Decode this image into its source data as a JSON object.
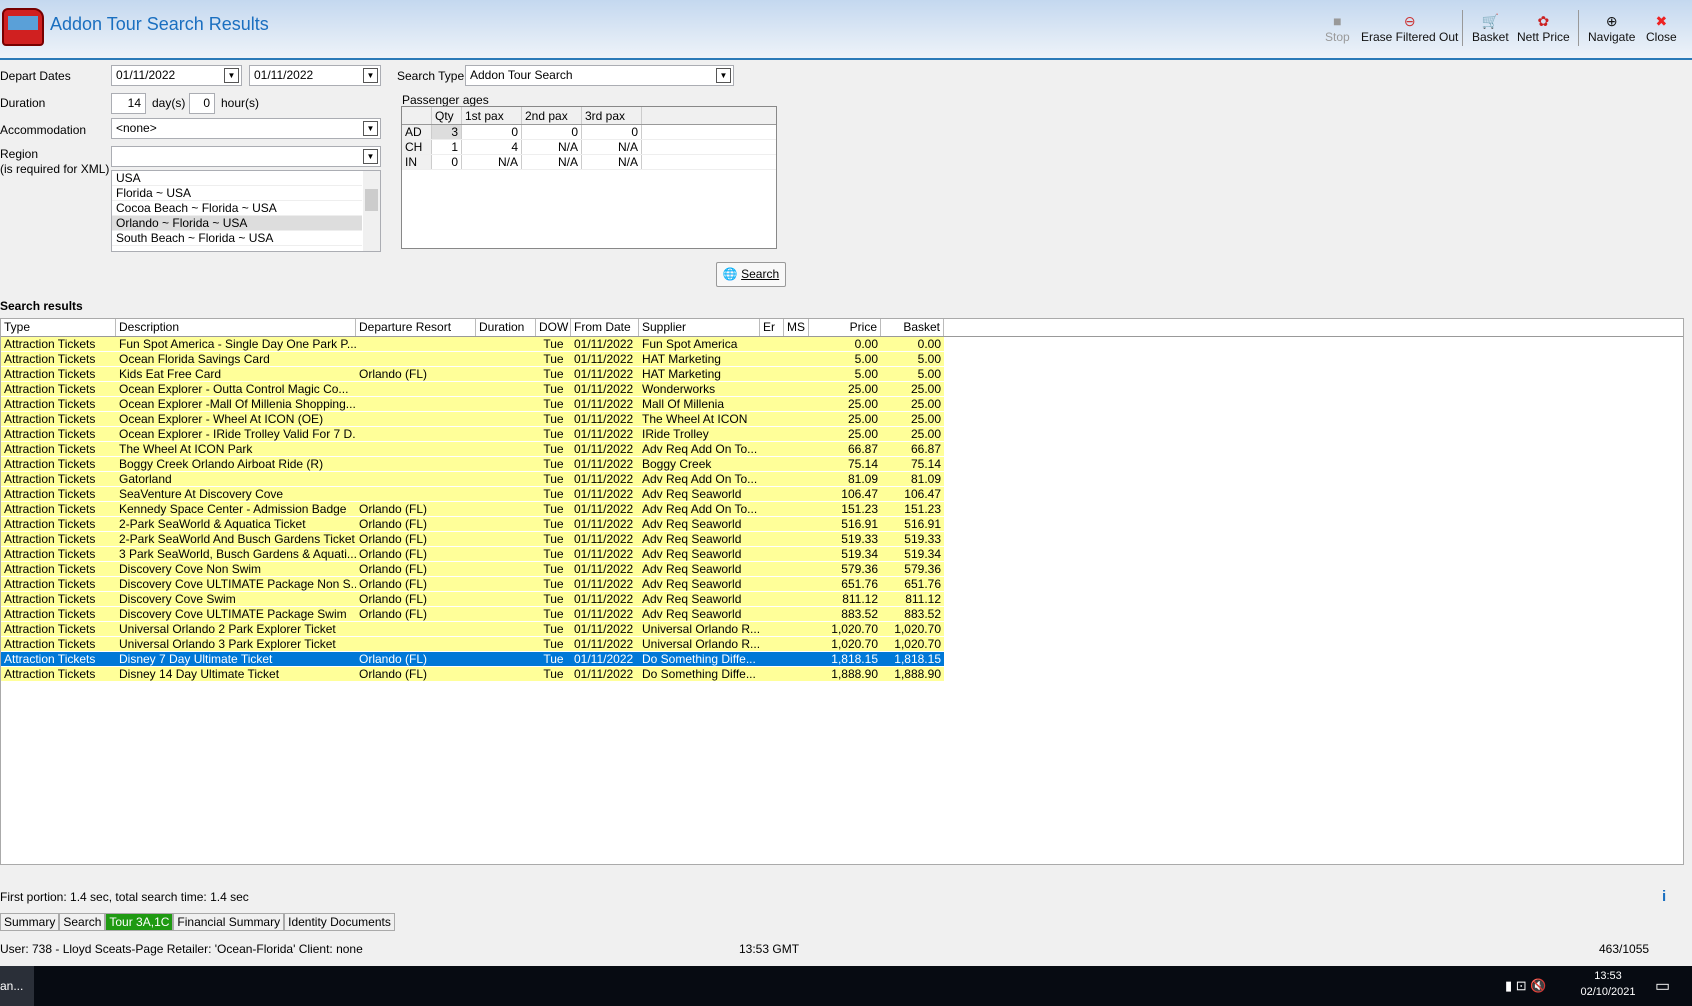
{
  "window": {
    "title": "Addon Tour Search Results"
  },
  "toolbar": {
    "stop": "Stop",
    "erase": "Erase Filtered Out",
    "basket": "Basket",
    "nett": "Nett Price",
    "navigate": "Navigate",
    "close": "Close"
  },
  "form": {
    "depart_label": "Depart Dates",
    "depart_from": "01/11/2022",
    "depart_to": "01/11/2022",
    "duration_label": "Duration",
    "days": "14",
    "days_unit": "day(s)",
    "hours": "0",
    "hours_unit": "hour(s)",
    "accom_label": "Accommodation",
    "accom_value": "<none>",
    "region_label": "Region",
    "region_note": "(is required for XML)",
    "region_value": "",
    "region_list": [
      "USA",
      "Florida ~ USA",
      "Cocoa Beach ~ Florida ~ USA",
      "Orlando ~ Florida ~ USA",
      "South Beach ~ Florida ~ USA"
    ],
    "search_type_label": "Search Type",
    "search_type_value": "Addon Tour Search",
    "search_button": "Search"
  },
  "passengers": {
    "label": "Passenger ages",
    "headers": [
      "",
      "Qty",
      "1st pax",
      "2nd pax",
      "3rd pax"
    ],
    "rows": [
      [
        "AD",
        "3",
        "0",
        "0",
        "0"
      ],
      [
        "CH",
        "1",
        "4",
        "N/A",
        "N/A"
      ],
      [
        "IN",
        "0",
        "N/A",
        "N/A",
        "N/A"
      ]
    ]
  },
  "results": {
    "label": "Search results",
    "headers": [
      "Type",
      "Description",
      "Departure Resort",
      "Duration",
      "DOW",
      "From Date",
      "Supplier",
      "Er",
      "MS",
      "Price",
      "Basket"
    ],
    "selected_index": 21,
    "rows": [
      [
        "Attraction Tickets",
        "Fun Spot America - Single Day One Park P...",
        "",
        "",
        "Tue",
        "01/11/2022",
        "Fun Spot America",
        "",
        "",
        "0.00",
        "0.00"
      ],
      [
        "Attraction Tickets",
        "Ocean Florida Savings Card",
        "",
        "",
        "Tue",
        "01/11/2022",
        "HAT Marketing",
        "",
        "",
        "5.00",
        "5.00"
      ],
      [
        "Attraction Tickets",
        "Kids Eat Free Card",
        "Orlando (FL)",
        "",
        "Tue",
        "01/11/2022",
        "HAT Marketing",
        "",
        "",
        "5.00",
        "5.00"
      ],
      [
        "Attraction Tickets",
        "Ocean Explorer - Outta Control Magic Co...",
        "",
        "",
        "Tue",
        "01/11/2022",
        "Wonderworks",
        "",
        "",
        "25.00",
        "25.00"
      ],
      [
        "Attraction Tickets",
        "Ocean Explorer -Mall Of Millenia Shopping...",
        "",
        "",
        "Tue",
        "01/11/2022",
        "Mall Of Millenia",
        "",
        "",
        "25.00",
        "25.00"
      ],
      [
        "Attraction Tickets",
        "Ocean Explorer - Wheel At ICON (OE)",
        "",
        "",
        "Tue",
        "01/11/2022",
        "The Wheel At ICON",
        "",
        "",
        "25.00",
        "25.00"
      ],
      [
        "Attraction Tickets",
        "Ocean Explorer - IRide Trolley Valid For 7 D...",
        "",
        "",
        "Tue",
        "01/11/2022",
        "IRide Trolley",
        "",
        "",
        "25.00",
        "25.00"
      ],
      [
        "Attraction Tickets",
        "The Wheel At ICON Park",
        "",
        "",
        "Tue",
        "01/11/2022",
        "Adv Req Add On To...",
        "",
        "",
        "66.87",
        "66.87"
      ],
      [
        "Attraction Tickets",
        "Boggy Creek Orlando Airboat Ride (R)",
        "",
        "",
        "Tue",
        "01/11/2022",
        "Boggy Creek",
        "",
        "",
        "75.14",
        "75.14"
      ],
      [
        "Attraction Tickets",
        "Gatorland",
        "",
        "",
        "Tue",
        "01/11/2022",
        "Adv Req Add On To...",
        "",
        "",
        "81.09",
        "81.09"
      ],
      [
        "Attraction Tickets",
        "SeaVenture At Discovery Cove",
        "",
        "",
        "Tue",
        "01/11/2022",
        "Adv Req Seaworld",
        "",
        "",
        "106.47",
        "106.47"
      ],
      [
        "Attraction Tickets",
        "Kennedy Space Center - Admission Badge",
        "Orlando (FL)",
        "",
        "Tue",
        "01/11/2022",
        "Adv Req Add On To...",
        "",
        "",
        "151.23",
        "151.23"
      ],
      [
        "Attraction Tickets",
        "2-Park SeaWorld & Aquatica Ticket",
        "Orlando (FL)",
        "",
        "Tue",
        "01/11/2022",
        "Adv Req Seaworld",
        "",
        "",
        "516.91",
        "516.91"
      ],
      [
        "Attraction Tickets",
        "2-Park SeaWorld And Busch Gardens Ticket",
        "Orlando (FL)",
        "",
        "Tue",
        "01/11/2022",
        "Adv Req Seaworld",
        "",
        "",
        "519.33",
        "519.33"
      ],
      [
        "Attraction Tickets",
        "3 Park SeaWorld, Busch Gardens & Aquati...",
        "Orlando (FL)",
        "",
        "Tue",
        "01/11/2022",
        "Adv Req Seaworld",
        "",
        "",
        "519.34",
        "519.34"
      ],
      [
        "Attraction Tickets",
        "Discovery Cove  Non Swim",
        "Orlando (FL)",
        "",
        "Tue",
        "01/11/2022",
        "Adv Req Seaworld",
        "",
        "",
        "579.36",
        "579.36"
      ],
      [
        "Attraction Tickets",
        "Discovery Cove ULTIMATE Package  Non S...",
        "Orlando (FL)",
        "",
        "Tue",
        "01/11/2022",
        "Adv Req Seaworld",
        "",
        "",
        "651.76",
        "651.76"
      ],
      [
        "Attraction Tickets",
        "Discovery Cove   Swim",
        "Orlando (FL)",
        "",
        "Tue",
        "01/11/2022",
        "Adv Req Seaworld",
        "",
        "",
        "811.12",
        "811.12"
      ],
      [
        "Attraction Tickets",
        "Discovery Cove ULTIMATE Package  Swim",
        "Orlando (FL)",
        "",
        "Tue",
        "01/11/2022",
        "Adv Req Seaworld",
        "",
        "",
        "883.52",
        "883.52"
      ],
      [
        "Attraction Tickets",
        "Universal Orlando 2 Park Explorer Ticket",
        "",
        "",
        "Tue",
        "01/11/2022",
        "Universal Orlando R...",
        "",
        "",
        "1,020.70",
        "1,020.70"
      ],
      [
        "Attraction Tickets",
        "Universal Orlando 3 Park Explorer Ticket",
        "",
        "",
        "Tue",
        "01/11/2022",
        "Universal Orlando R...",
        "",
        "",
        "1,020.70",
        "1,020.70"
      ],
      [
        "Attraction Tickets",
        "Disney 7 Day Ultimate Ticket",
        "Orlando (FL)",
        "",
        "Tue",
        "01/11/2022",
        "Do Something Diffe...",
        "",
        "",
        "1,818.15",
        "1,818.15"
      ],
      [
        "Attraction Tickets",
        "Disney 14 Day Ultimate Ticket",
        "Orlando (FL)",
        "",
        "Tue",
        "01/11/2022",
        "Do Something Diffe...",
        "",
        "",
        "1,888.90",
        "1,888.90"
      ]
    ]
  },
  "status": {
    "timing": "First portion: 1.4 sec, total search time: 1.4 sec",
    "info": "i",
    "user": "User: 738 - Lloyd Sceats-Page   Retailer: 'Ocean-Florida'   Client: none",
    "time": "13:53 GMT",
    "count": "463/1055"
  },
  "tabs": [
    "Summary",
    "Search",
    "Tour 3A,1C",
    "Financial Summary",
    "Identity Documents"
  ],
  "active_tab": 2,
  "taskbar": {
    "app": "an...",
    "clock_time": "13:53",
    "clock_date": "02/10/2021"
  },
  "colors": {
    "row_yellow": "#ffff99",
    "selection": "#0078d7",
    "active_tab": "#1f9a12"
  }
}
